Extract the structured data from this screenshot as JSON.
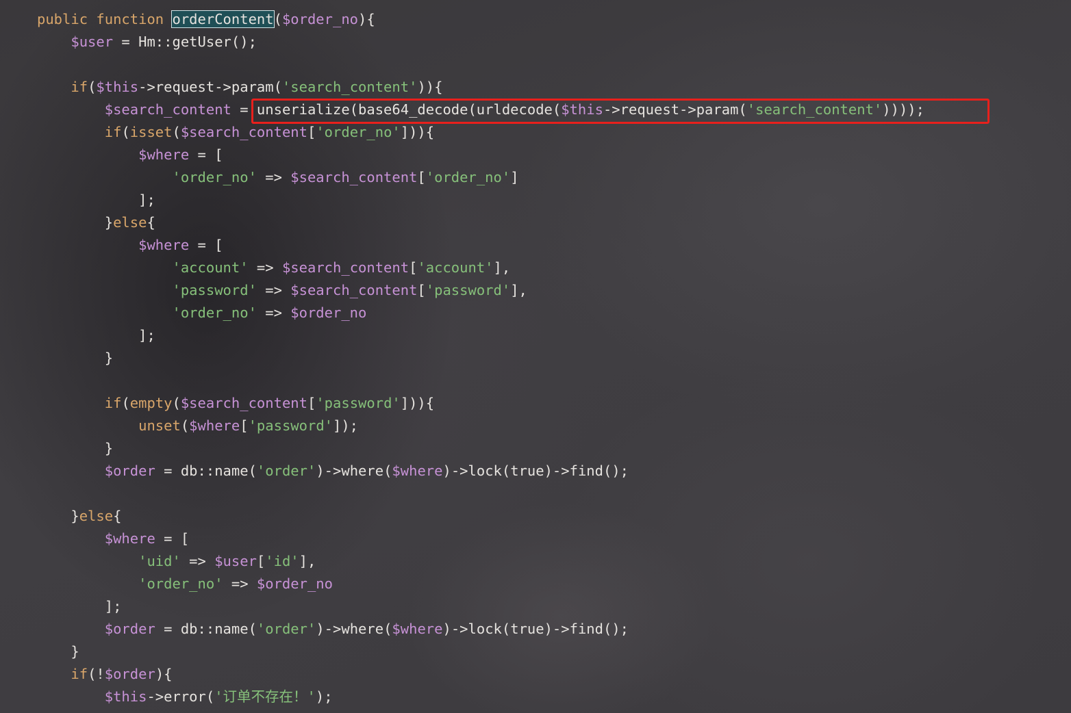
{
  "editor": {
    "language": "php",
    "colors": {
      "keyword": "#d9a66a",
      "variable": "#c792d6",
      "string": "#86c07a",
      "plain": "#e6e3df",
      "highlight_box": "#e8201c",
      "function_name_highlight": "#1f4f56"
    },
    "lines": [
      [
        {
          "t": "public function ",
          "c": "k"
        },
        {
          "t": "orderContent",
          "c": "h"
        },
        {
          "t": "(",
          "c": "p"
        },
        {
          "t": "$order_no",
          "c": "v"
        },
        {
          "t": "){",
          "c": "p"
        }
      ],
      [
        {
          "t": "    ",
          "c": "p"
        },
        {
          "t": "$user",
          "c": "v"
        },
        {
          "t": " = Hm::getUser();",
          "c": "p"
        }
      ],
      [],
      [
        {
          "t": "    ",
          "c": "p"
        },
        {
          "t": "if",
          "c": "k"
        },
        {
          "t": "(",
          "c": "p"
        },
        {
          "t": "$this",
          "c": "v"
        },
        {
          "t": "->request->param(",
          "c": "p"
        },
        {
          "t": "'search_content'",
          "c": "s"
        },
        {
          "t": ")){",
          "c": "p"
        }
      ],
      [
        {
          "t": "        ",
          "c": "p"
        },
        {
          "t": "$search_content",
          "c": "v"
        },
        {
          "t": " = unserialize(base64_decode(urldecode(",
          "c": "p"
        },
        {
          "t": "$this",
          "c": "v"
        },
        {
          "t": "->request->param(",
          "c": "p"
        },
        {
          "t": "'search_content'",
          "c": "s"
        },
        {
          "t": "))));",
          "c": "p"
        }
      ],
      [
        {
          "t": "        ",
          "c": "p"
        },
        {
          "t": "if",
          "c": "k"
        },
        {
          "t": "(",
          "c": "p"
        },
        {
          "t": "isset",
          "c": "k"
        },
        {
          "t": "(",
          "c": "p"
        },
        {
          "t": "$search_content",
          "c": "v"
        },
        {
          "t": "[",
          "c": "p"
        },
        {
          "t": "'order_no'",
          "c": "s"
        },
        {
          "t": "])){",
          "c": "p"
        }
      ],
      [
        {
          "t": "            ",
          "c": "p"
        },
        {
          "t": "$where",
          "c": "v"
        },
        {
          "t": " = [",
          "c": "p"
        }
      ],
      [
        {
          "t": "                ",
          "c": "p"
        },
        {
          "t": "'order_no'",
          "c": "s"
        },
        {
          "t": " => ",
          "c": "p"
        },
        {
          "t": "$search_content",
          "c": "v"
        },
        {
          "t": "[",
          "c": "p"
        },
        {
          "t": "'order_no'",
          "c": "s"
        },
        {
          "t": "]",
          "c": "p"
        }
      ],
      [
        {
          "t": "            ];",
          "c": "p"
        }
      ],
      [
        {
          "t": "        }",
          "c": "p"
        },
        {
          "t": "else",
          "c": "k"
        },
        {
          "t": "{",
          "c": "p"
        }
      ],
      [
        {
          "t": "            ",
          "c": "p"
        },
        {
          "t": "$where",
          "c": "v"
        },
        {
          "t": " = [",
          "c": "p"
        }
      ],
      [
        {
          "t": "                ",
          "c": "p"
        },
        {
          "t": "'account'",
          "c": "s"
        },
        {
          "t": " => ",
          "c": "p"
        },
        {
          "t": "$search_content",
          "c": "v"
        },
        {
          "t": "[",
          "c": "p"
        },
        {
          "t": "'account'",
          "c": "s"
        },
        {
          "t": "],",
          "c": "p"
        }
      ],
      [
        {
          "t": "                ",
          "c": "p"
        },
        {
          "t": "'password'",
          "c": "s"
        },
        {
          "t": " => ",
          "c": "p"
        },
        {
          "t": "$search_content",
          "c": "v"
        },
        {
          "t": "[",
          "c": "p"
        },
        {
          "t": "'password'",
          "c": "s"
        },
        {
          "t": "],",
          "c": "p"
        }
      ],
      [
        {
          "t": "                ",
          "c": "p"
        },
        {
          "t": "'order_no'",
          "c": "s"
        },
        {
          "t": " => ",
          "c": "p"
        },
        {
          "t": "$order_no",
          "c": "v"
        }
      ],
      [
        {
          "t": "            ];",
          "c": "p"
        }
      ],
      [
        {
          "t": "        }",
          "c": "p"
        }
      ],
      [],
      [
        {
          "t": "        ",
          "c": "p"
        },
        {
          "t": "if",
          "c": "k"
        },
        {
          "t": "(",
          "c": "p"
        },
        {
          "t": "empty",
          "c": "k"
        },
        {
          "t": "(",
          "c": "p"
        },
        {
          "t": "$search_content",
          "c": "v"
        },
        {
          "t": "[",
          "c": "p"
        },
        {
          "t": "'password'",
          "c": "s"
        },
        {
          "t": "])){",
          "c": "p"
        }
      ],
      [
        {
          "t": "            ",
          "c": "p"
        },
        {
          "t": "unset",
          "c": "k"
        },
        {
          "t": "(",
          "c": "p"
        },
        {
          "t": "$where",
          "c": "v"
        },
        {
          "t": "[",
          "c": "p"
        },
        {
          "t": "'password'",
          "c": "s"
        },
        {
          "t": "]);",
          "c": "p"
        }
      ],
      [
        {
          "t": "        }",
          "c": "p"
        }
      ],
      [
        {
          "t": "        ",
          "c": "p"
        },
        {
          "t": "$order",
          "c": "v"
        },
        {
          "t": " = db::name(",
          "c": "p"
        },
        {
          "t": "'order'",
          "c": "s"
        },
        {
          "t": ")->where(",
          "c": "p"
        },
        {
          "t": "$where",
          "c": "v"
        },
        {
          "t": ")->lock(true)->find();",
          "c": "p"
        }
      ],
      [],
      [
        {
          "t": "    }",
          "c": "p"
        },
        {
          "t": "else",
          "c": "k"
        },
        {
          "t": "{",
          "c": "p"
        }
      ],
      [
        {
          "t": "        ",
          "c": "p"
        },
        {
          "t": "$where",
          "c": "v"
        },
        {
          "t": " = [",
          "c": "p"
        }
      ],
      [
        {
          "t": "            ",
          "c": "p"
        },
        {
          "t": "'uid'",
          "c": "s"
        },
        {
          "t": " => ",
          "c": "p"
        },
        {
          "t": "$user",
          "c": "v"
        },
        {
          "t": "[",
          "c": "p"
        },
        {
          "t": "'id'",
          "c": "s"
        },
        {
          "t": "],",
          "c": "p"
        }
      ],
      [
        {
          "t": "            ",
          "c": "p"
        },
        {
          "t": "'order_no'",
          "c": "s"
        },
        {
          "t": " => ",
          "c": "p"
        },
        {
          "t": "$order_no",
          "c": "v"
        }
      ],
      [
        {
          "t": "        ];",
          "c": "p"
        }
      ],
      [
        {
          "t": "        ",
          "c": "p"
        },
        {
          "t": "$order",
          "c": "v"
        },
        {
          "t": " = db::name(",
          "c": "p"
        },
        {
          "t": "'order'",
          "c": "s"
        },
        {
          "t": ")->where(",
          "c": "p"
        },
        {
          "t": "$where",
          "c": "v"
        },
        {
          "t": ")->lock(true)->find();",
          "c": "p"
        }
      ],
      [
        {
          "t": "    }",
          "c": "p"
        }
      ],
      [
        {
          "t": "    ",
          "c": "p"
        },
        {
          "t": "if",
          "c": "k"
        },
        {
          "t": "(!",
          "c": "p"
        },
        {
          "t": "$order",
          "c": "v"
        },
        {
          "t": "){",
          "c": "p"
        }
      ],
      [
        {
          "t": "        ",
          "c": "p"
        },
        {
          "t": "$this",
          "c": "v"
        },
        {
          "t": "->error(",
          "c": "p"
        },
        {
          "t": "'订单不存在！'",
          "c": "s"
        },
        {
          "t": ");",
          "c": "p"
        }
      ]
    ]
  }
}
